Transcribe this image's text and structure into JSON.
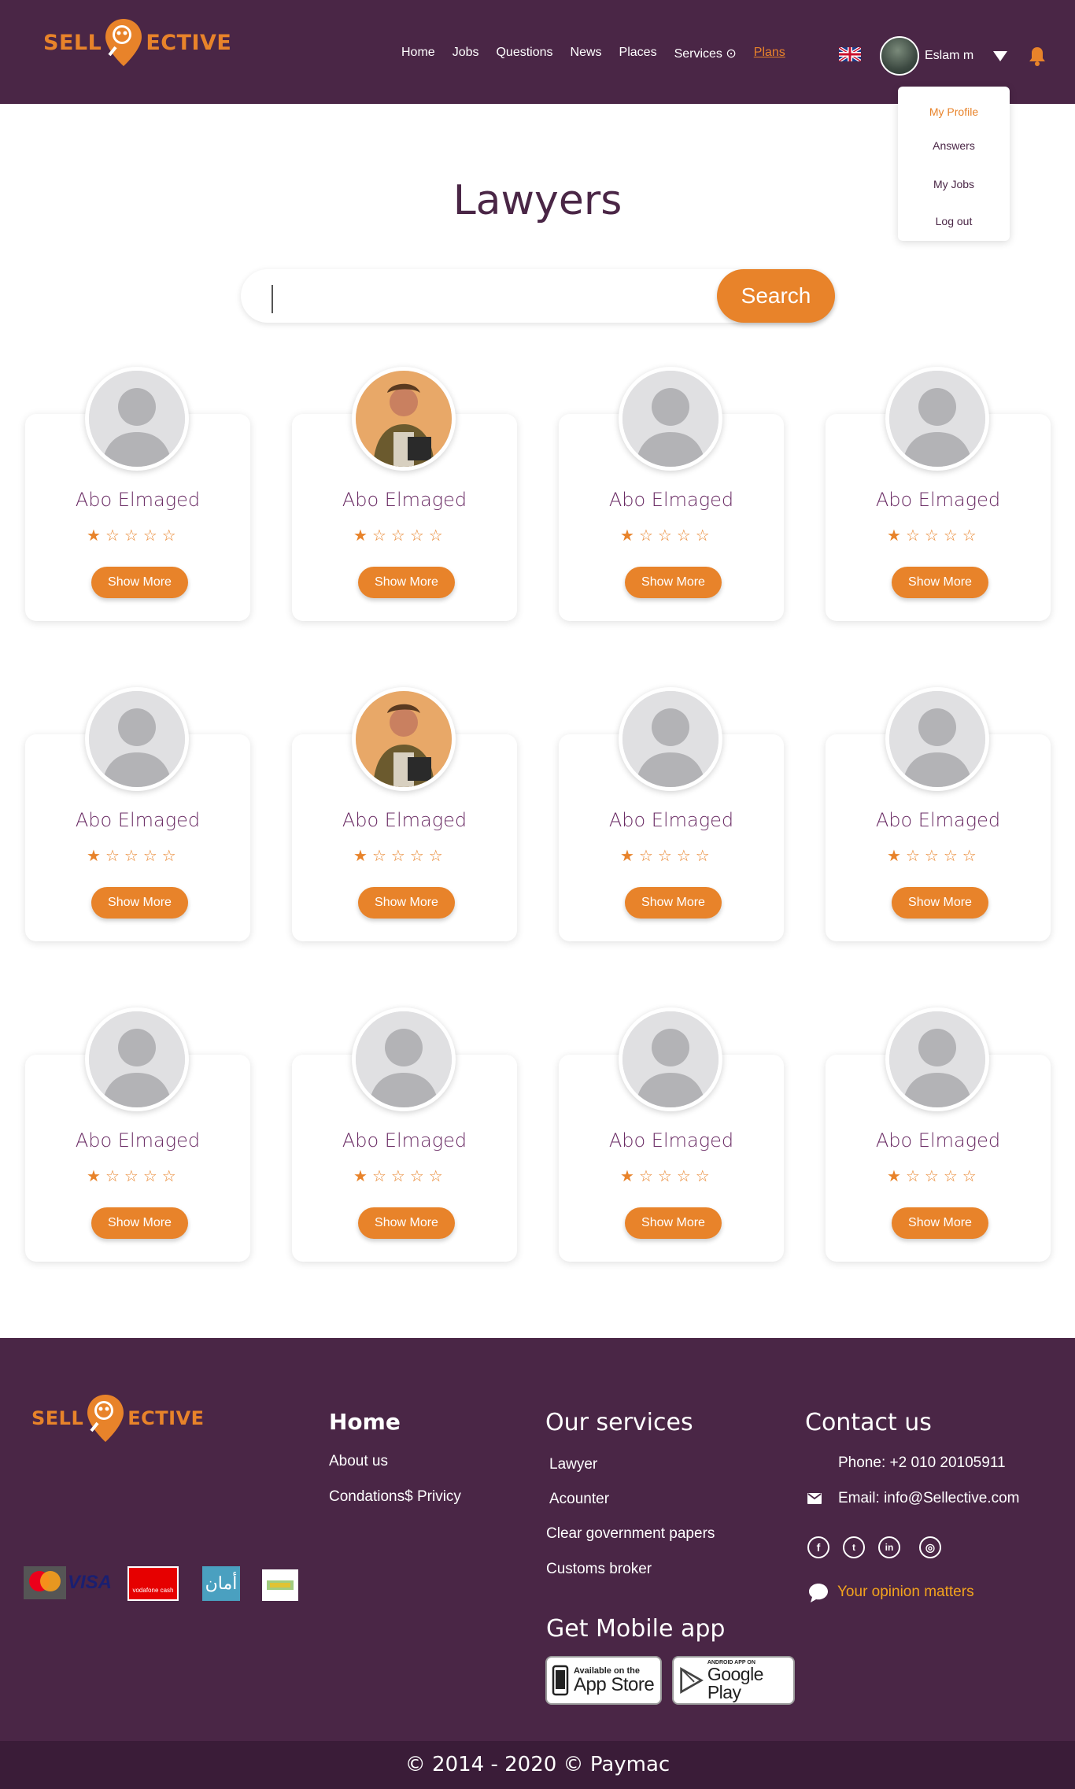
{
  "brand": {
    "logo_left": "SELL",
    "logo_right": "ECTIVE",
    "accent": "#e8832a",
    "header_bg": "#4a2646"
  },
  "nav": {
    "items": [
      "Home",
      "Jobs",
      "Questions",
      "News",
      "Places",
      "Services ⊙",
      "Plans"
    ]
  },
  "user": {
    "name": "Eslam m",
    "language_flag": "uk-flag-icon"
  },
  "dropdown": {
    "items": [
      "My Profile",
      "Answers",
      "My Jobs",
      "Log out"
    ]
  },
  "page": {
    "title": "Lawyers"
  },
  "search": {
    "button_label": "Search",
    "value": ""
  },
  "cards": [
    {
      "name": "Abo Elmaged",
      "rating": 1,
      "max_rating": 5,
      "avatar": "placeholder",
      "button": "Show More"
    },
    {
      "name": "Abo Elmaged",
      "rating": 1,
      "max_rating": 5,
      "avatar": "photo",
      "button": "Show More"
    },
    {
      "name": "Abo Elmaged",
      "rating": 1,
      "max_rating": 5,
      "avatar": "placeholder",
      "button": "Show More"
    },
    {
      "name": "Abo Elmaged",
      "rating": 1,
      "max_rating": 5,
      "avatar": "placeholder",
      "button": "Show More"
    },
    {
      "name": "Abo Elmaged",
      "rating": 1,
      "max_rating": 5,
      "avatar": "placeholder",
      "button": "Show More"
    },
    {
      "name": "Abo Elmaged",
      "rating": 1,
      "max_rating": 5,
      "avatar": "photo",
      "button": "Show More"
    },
    {
      "name": "Abo Elmaged",
      "rating": 1,
      "max_rating": 5,
      "avatar": "placeholder",
      "button": "Show More"
    },
    {
      "name": "Abo Elmaged",
      "rating": 1,
      "max_rating": 5,
      "avatar": "placeholder",
      "button": "Show More"
    },
    {
      "name": "Abo Elmaged",
      "rating": 1,
      "max_rating": 5,
      "avatar": "placeholder",
      "button": "Show More"
    },
    {
      "name": "Abo Elmaged",
      "rating": 1,
      "max_rating": 5,
      "avatar": "placeholder",
      "button": "Show More"
    },
    {
      "name": "Abo Elmaged",
      "rating": 1,
      "max_rating": 5,
      "avatar": "placeholder",
      "button": "Show More"
    },
    {
      "name": "Abo Elmaged",
      "rating": 1,
      "max_rating": 5,
      "avatar": "placeholder",
      "button": "Show More"
    }
  ],
  "footer": {
    "home": {
      "heading": "Home",
      "links": [
        "About us",
        "Condations$ Privicy"
      ]
    },
    "services": {
      "heading": "Our services",
      "links": [
        "Lawyer",
        "Acounter",
        "Clear government papers",
        "Customs broker"
      ]
    },
    "mobile": {
      "heading": "Get Mobile app",
      "app_store_small": "Available on the",
      "app_store": "App Store",
      "google_small": "ANDROID APP ON",
      "google": "Google Play"
    },
    "contact": {
      "heading": "Contact us",
      "phone": "Phone: +2 010 20105911",
      "email": "Email: info@Sellective.com",
      "opinion": "Your opinion matters"
    },
    "payments": {
      "vodafone": "vodafone cash",
      "aman": "أمان"
    },
    "copyright": "© 2014 - 2020 © Paymac"
  }
}
